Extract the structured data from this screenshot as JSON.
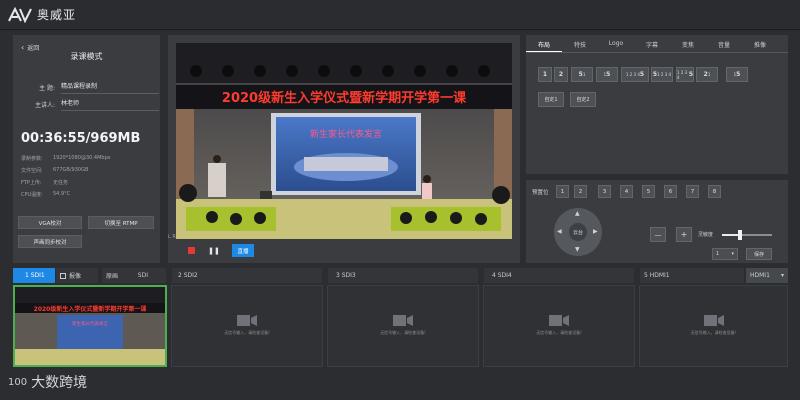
{
  "app": {
    "brand": "奥威亚"
  },
  "left_panel": {
    "back_label": "返回",
    "title": "录课模式",
    "subject_label": "主 题:",
    "subject_value": "精品课程录制",
    "speaker_label": "主讲人:",
    "speaker_value": "林老师",
    "timer": "00:36:55/969MB",
    "info": [
      {
        "k": "录制参数:",
        "v": "1920*1080@30.4Mbps"
      },
      {
        "k": "文件空间:",
        "v": "677GB/930GB"
      },
      {
        "k": "FTP上传:",
        "v": "无任务"
      },
      {
        "k": "CPU温度:",
        "v": "54.9°C"
      }
    ],
    "buttons": {
      "vga": "VGA校对",
      "rtmp": "切换至 RTMP",
      "audio": "声画同步校对"
    }
  },
  "preview": {
    "banner_text": "2020级新生入学仪式暨新学期开学第一课",
    "screen_text": "新生家长代表发言",
    "lr": "L R",
    "stop_icon": "stop-icon",
    "pause_icon": "pause-icon",
    "live_label": "直播"
  },
  "right_tabs": [
    "布局",
    "特技",
    "Logo",
    "字幕",
    "变焦",
    "音量",
    "推像"
  ],
  "layouts_row1": [
    {
      "main": "1",
      "sub": ""
    },
    {
      "main": "2",
      "sub": ""
    },
    {
      "main": "5",
      "sub": "1"
    },
    {
      "main": "5",
      "sub": "1"
    },
    {
      "main": "5",
      "sub": "1 2 3 4"
    },
    {
      "main": "5",
      "sub": "1 2 3 4"
    },
    {
      "main": "5",
      "sub": "1 2 3 4"
    },
    {
      "main": "2",
      "sub": "1"
    },
    {
      "main": "5",
      "sub": "1"
    }
  ],
  "layout_custom": [
    "自定1",
    "自定2"
  ],
  "ptz": {
    "preset_label": "预置位",
    "presets": [
      "1",
      "2",
      "3",
      "4",
      "5",
      "6",
      "7",
      "8"
    ],
    "joystick_label": "云台",
    "minus": "—",
    "plus": "+",
    "sensitivity_label": "灵敏度",
    "slider_value": 0.35,
    "select_value": "1",
    "save_label": "保存"
  },
  "channels": [
    {
      "label": "1 SDI1",
      "active": true,
      "extra": "报像"
    },
    {
      "label": "原画",
      "extra": "SDI"
    },
    {
      "label": "2 SDI2"
    },
    {
      "label": "3 SDI3"
    },
    {
      "label": "4 SDI4"
    },
    {
      "label": "5 HDMI1",
      "select": "HDMI1"
    }
  ],
  "no_signal": "无信号输入，请检查设备!",
  "watermark": {
    "text": "大数跨境",
    "mark": "100"
  },
  "colors": {
    "accent": "#1e88e5",
    "record_red": "#e53935",
    "active_green": "#4caf50"
  }
}
